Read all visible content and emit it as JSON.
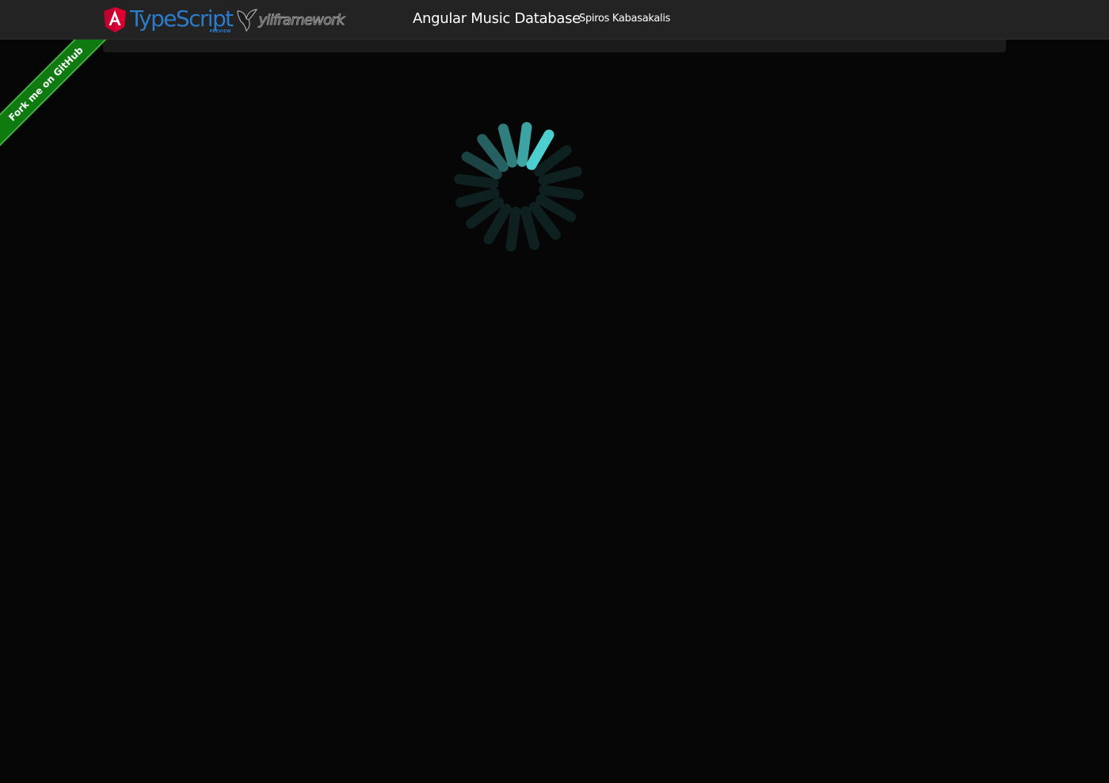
{
  "header": {
    "typescript_logo_text": "TypeScript",
    "typescript_logo_tag": "PREVIEW",
    "yii_logo_text": "yiiframework",
    "app_title": "Angular Music Database",
    "author": "Spiros Kabasakalis"
  },
  "ribbon": {
    "label": "Fork me on GitHub"
  },
  "colors": {
    "background": "#060606",
    "navbar": "#232323",
    "spinner": "#4ecfcf",
    "ribbon": "#0f7a0f",
    "typescript": "#2b7bc9"
  },
  "icons": {
    "angular": "angular-shield-logo",
    "yii": "yii-bird-logo",
    "loading": "loading-spinner-icon"
  }
}
